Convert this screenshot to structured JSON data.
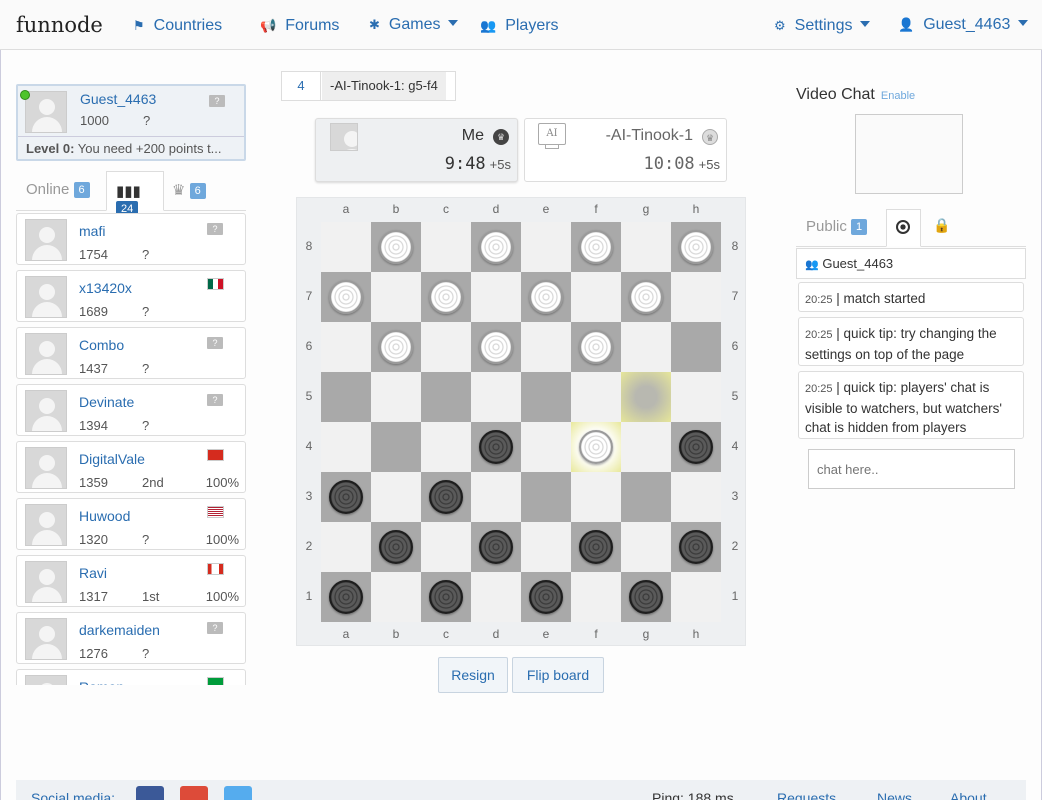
{
  "brand": {
    "text": "funnode"
  },
  "nav": {
    "countries": "Countries",
    "forums": "Forums",
    "games": "Games",
    "players": "Players",
    "settings": "Settings",
    "user": "Guest_4463"
  },
  "me": {
    "name": "Guest_4463",
    "score": "1000",
    "rank": "?",
    "level": "Level 0:",
    "level_text": " You need +200 points t..."
  },
  "player_tabs": [
    {
      "label": "Online",
      "count": "6"
    },
    {
      "label": "",
      "count": "24",
      "icon": "ranking-icon"
    },
    {
      "label": "",
      "count": "6",
      "icon": "crown-icon"
    }
  ],
  "players": [
    {
      "name": "mafi",
      "score": "1754",
      "place": "?",
      "pct": "",
      "flag": "?"
    },
    {
      "name": "x13420x",
      "score": "1689",
      "place": "?",
      "pct": "",
      "flag": "MX"
    },
    {
      "name": "Combo",
      "score": "1437",
      "place": "?",
      "pct": "",
      "flag": "?"
    },
    {
      "name": "Devinate",
      "score": "1394",
      "place": "?",
      "pct": "",
      "flag": "?"
    },
    {
      "name": "DigitalVale",
      "score": "1359",
      "place": "2nd",
      "pct": "100%",
      "flag": "CH"
    },
    {
      "name": "Huwood",
      "score": "1320",
      "place": "?",
      "pct": "100%",
      "flag": "US"
    },
    {
      "name": "Ravi",
      "score": "1317",
      "place": "1st",
      "pct": "100%",
      "flag": "CA"
    },
    {
      "name": "darkemaiden",
      "score": "1276",
      "place": "?",
      "pct": "",
      "flag": "?"
    },
    {
      "name": "Ramon",
      "score": "",
      "place": "",
      "pct": "",
      "flag": "BR"
    }
  ],
  "last_move": {
    "number": "4",
    "text": "-AI-Tinook-1: g5-f4"
  },
  "player_me": {
    "name": "Me",
    "clock": "9:48",
    "increment": "+5s"
  },
  "player_ai": {
    "name": "-AI-Tinook-1",
    "clock": "10:08",
    "increment": "+5s",
    "avatar_text": "AI"
  },
  "board": {
    "files": [
      "a",
      "b",
      "c",
      "d",
      "e",
      "f",
      "g",
      "h"
    ],
    "ranks": [
      "8",
      "7",
      "6",
      "5",
      "4",
      "3",
      "2",
      "1"
    ],
    "pieces": {
      "b8": "white",
      "d8": "white",
      "f8": "white",
      "h8": "white",
      "a7": "white",
      "c7": "white",
      "e7": "white",
      "g7": "white",
      "b6": "white",
      "d6": "white",
      "f6": "white",
      "f4": "white",
      "d4": "black",
      "h4": "black",
      "a3": "black",
      "c3": "black",
      "b2": "black",
      "d2": "black",
      "f2": "black",
      "h2": "black",
      "a1": "black",
      "c1": "black",
      "e1": "black",
      "g1": "black"
    },
    "highlight_from": "g5",
    "highlight_to": "f4"
  },
  "actions": {
    "resign": "Resign",
    "flip": "Flip board"
  },
  "video": {
    "title": "Video Chat",
    "enable": "Enable"
  },
  "chat": {
    "tab_public": "Public",
    "tab_public_count": "1",
    "user": "Guest_4463",
    "messages": [
      {
        "time": "20:25",
        "text": "match started"
      },
      {
        "time": "20:25",
        "text": "quick tip: try changing the settings on top of the page"
      },
      {
        "time": "20:25",
        "text": "quick tip: players' chat is visible to watchers, but watchers' chat is hidden from players"
      }
    ],
    "placeholder": "chat here.."
  },
  "footer": {
    "social": "Social media:",
    "ping": "Ping: 188 ms",
    "requests": "Requests",
    "news": "News",
    "about": "About"
  },
  "colors": {
    "accent": "#2a6db0",
    "badge": "#6fa8dc",
    "dark_square": "#a9a9a9",
    "light_square": "#f1f1f1"
  }
}
